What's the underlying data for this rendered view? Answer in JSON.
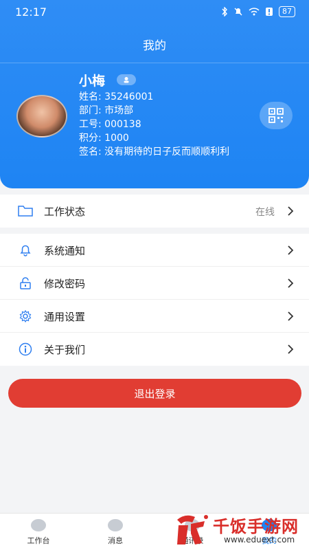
{
  "status_bar": {
    "time": "12:17",
    "battery": "87"
  },
  "nav": {
    "title": "我的"
  },
  "profile": {
    "name": "小梅",
    "employee_name_line": "姓名: 35246001",
    "department_line": "部门: 市场部",
    "employee_id_line": "工号: 000138",
    "points_line": "积分: 1000",
    "signature_line": "签名: 没有期待的日子反而顺顺利利"
  },
  "status_row": {
    "label": "工作状态",
    "value": "在线"
  },
  "menu": [
    {
      "label": "系统通知",
      "icon": "bell-icon"
    },
    {
      "label": "修改密码",
      "icon": "lock-icon"
    },
    {
      "label": "通用设置",
      "icon": "gear-icon"
    },
    {
      "label": "关于我们",
      "icon": "info-icon"
    }
  ],
  "logout_label": "退出登录",
  "tabs": [
    {
      "label": "工作台",
      "icon": "dashboard-icon"
    },
    {
      "label": "消息",
      "icon": "message-icon"
    },
    {
      "label": "通讯录",
      "icon": "contacts-icon"
    },
    {
      "label": "我的",
      "icon": "profile-icon",
      "active": true
    }
  ],
  "watermark": {
    "text": "千饭手游网",
    "url": "www.eduext.com"
  },
  "colors": {
    "primary": "#1e84f3",
    "logout": "#e13d33",
    "watermark": "#d92e2a"
  }
}
